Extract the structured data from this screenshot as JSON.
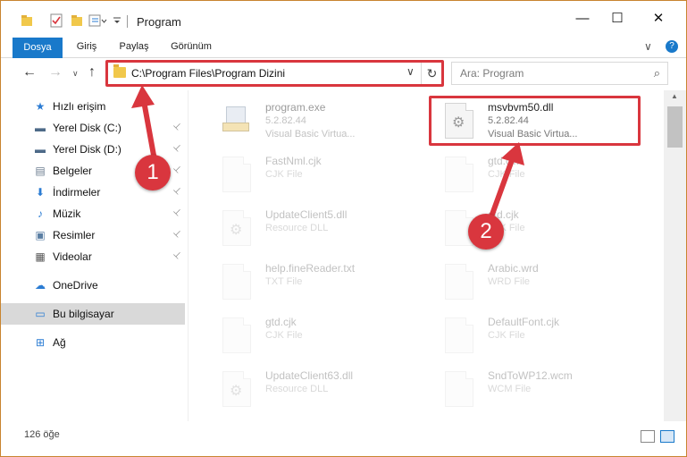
{
  "window": {
    "title": "Program",
    "minimize_glyph": "—",
    "maximize_glyph": "☐",
    "close_glyph": "✕"
  },
  "ribbon": {
    "tabs": [
      "Dosya",
      "Giriş",
      "Paylaş",
      "Görünüm"
    ],
    "collapse_glyph": "∨",
    "help_glyph": "?"
  },
  "nav": {
    "back_glyph": "←",
    "forward_glyph": "→",
    "recent_glyph": "∨",
    "up_glyph": "↑",
    "address": "C:\\Program Files\\Program Dizini",
    "dropdown_glyph": "∨",
    "refresh_glyph": "↻",
    "search_placeholder": "Ara: Program",
    "search_glyph": "⌕"
  },
  "sidebar": {
    "items": [
      {
        "label": "Hızlı erişim",
        "icon": "star-icon",
        "glyph": "★",
        "color": "#2b7cd3",
        "pinned": false
      },
      {
        "label": "Yerel Disk (C:)",
        "icon": "drive-icon",
        "glyph": "▬",
        "color": "#4d6a88",
        "pinned": true
      },
      {
        "label": "Yerel Disk (D:)",
        "icon": "drive-icon",
        "glyph": "▬",
        "color": "#4d6a88",
        "pinned": true
      },
      {
        "label": "Belgeler",
        "icon": "documents-icon",
        "glyph": "▤",
        "color": "#6b7c8f",
        "pinned": true
      },
      {
        "label": "İndirmeler",
        "icon": "download-icon",
        "glyph": "⬇",
        "color": "#2b7cd3",
        "pinned": true
      },
      {
        "label": "Müzik",
        "icon": "music-icon",
        "glyph": "♪",
        "color": "#2b7cd3",
        "pinned": true
      },
      {
        "label": "Resimler",
        "icon": "pictures-icon",
        "glyph": "▣",
        "color": "#5a7ea3",
        "pinned": true
      },
      {
        "label": "Videolar",
        "icon": "video-icon",
        "glyph": "▦",
        "color": "#555555",
        "pinned": true
      },
      {
        "label": "OneDrive",
        "icon": "cloud-icon",
        "glyph": "☁",
        "color": "#2b7cd3",
        "pinned": false
      },
      {
        "label": "Bu bilgisayar",
        "icon": "computer-icon",
        "glyph": "▭",
        "color": "#2b7cd3",
        "pinned": false
      },
      {
        "label": "Ağ",
        "icon": "network-icon",
        "glyph": "⊞",
        "color": "#2b7cd3",
        "pinned": false
      }
    ],
    "pin_glyph": "📌"
  },
  "files": [
    {
      "name": "program.exe",
      "line2": "5.2.82.44",
      "line3": "Visual Basic Virtua...",
      "icon": "exe-icon",
      "highlight": false
    },
    {
      "name": "msvbvm50.dll",
      "line2": "5.2.82.44",
      "line3": "Visual Basic Virtua...",
      "icon": "gear-file-icon",
      "highlight": true
    },
    {
      "name": "FastNml.cjk",
      "line2": "CJK File",
      "line3": "",
      "icon": "file-icon",
      "highlight": false
    },
    {
      "name": "gtd.cjk",
      "line2": "CJK File",
      "line3": "",
      "icon": "file-icon",
      "highlight": false
    },
    {
      "name": "UpdateClient5.dll",
      "line2": "Resource DLL",
      "line3": "",
      "icon": "gear-file-icon",
      "highlight": false
    },
    {
      "name": "gtd.cjk",
      "line2": "CJK File",
      "line3": "",
      "icon": "file-icon",
      "highlight": false
    },
    {
      "name": "help.fineReader.txt",
      "line2": "TXT File",
      "line3": "",
      "icon": "file-icon",
      "highlight": false
    },
    {
      "name": "Arabic.wrd",
      "line2": "WRD File",
      "line3": "",
      "icon": "file-icon",
      "highlight": false
    },
    {
      "name": "gtd.cjk",
      "line2": "CJK File",
      "line3": "",
      "icon": "file-icon",
      "highlight": false
    },
    {
      "name": "DefaultFont.cjk",
      "line2": "CJK File",
      "line3": "",
      "icon": "file-icon",
      "highlight": false
    },
    {
      "name": "UpdateClient63.dll",
      "line2": "Resource DLL",
      "line3": "",
      "icon": "gear-file-icon",
      "highlight": false
    },
    {
      "name": "SndToWP12.wcm",
      "line2": "WCM File",
      "line3": "",
      "icon": "file-icon",
      "highlight": false
    }
  ],
  "status": {
    "count": "126 öğe"
  },
  "annotations": {
    "badge1": "1",
    "badge2": "2",
    "color": "#d9363e"
  }
}
